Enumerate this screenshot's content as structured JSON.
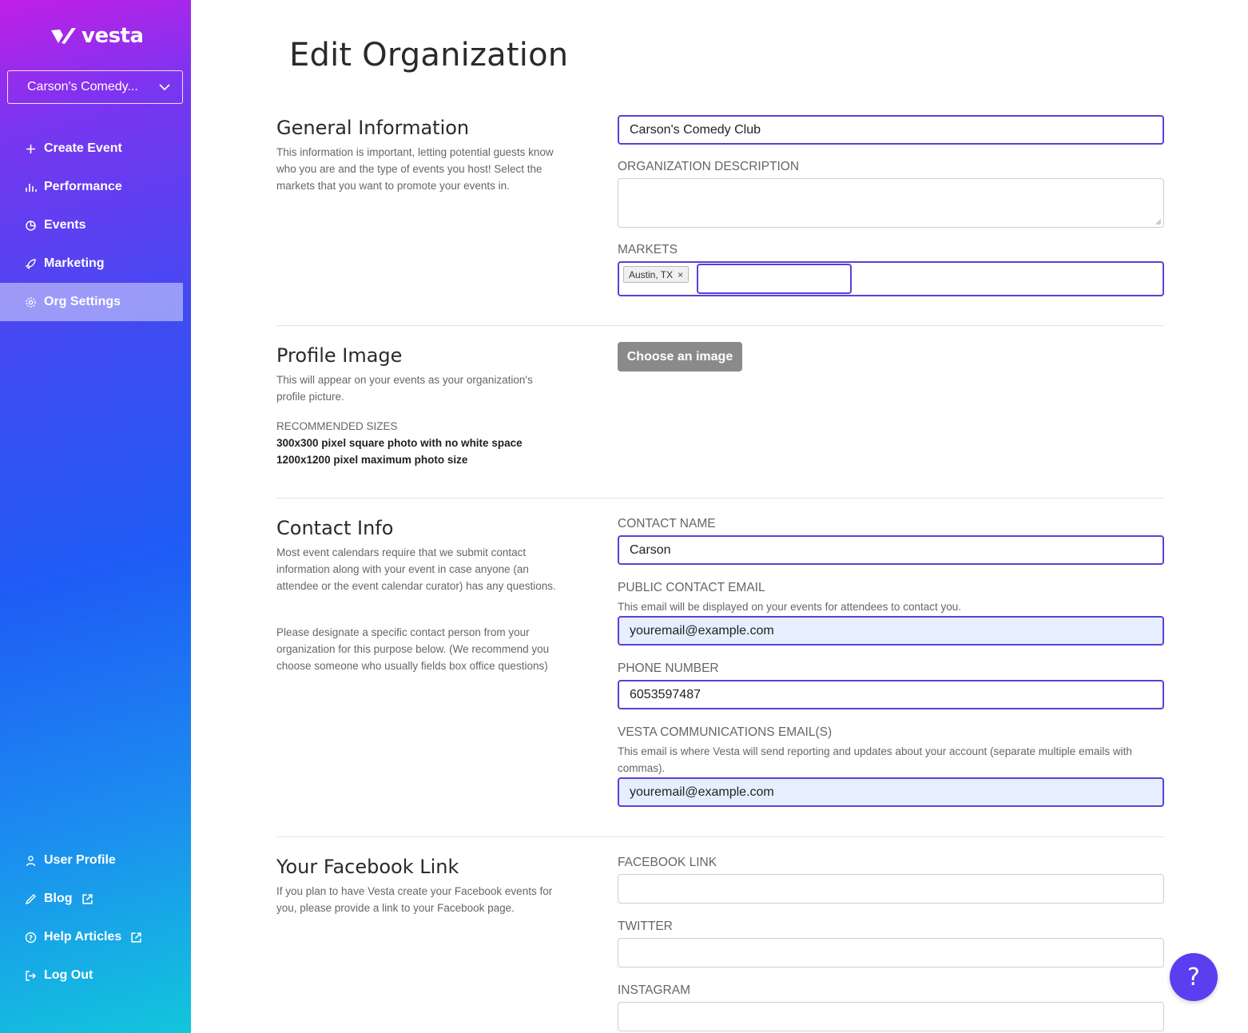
{
  "sidebar": {
    "logo_text": "vesta",
    "org_selector": "Carson's Comedy...",
    "nav_items": [
      {
        "label": "Create Event",
        "icon": "plus-icon"
      },
      {
        "label": "Performance",
        "icon": "bar-chart-icon"
      },
      {
        "label": "Events",
        "icon": "pie-chart-icon"
      },
      {
        "label": "Marketing",
        "icon": "rocket-icon"
      },
      {
        "label": "Org Settings",
        "icon": "gear-icon",
        "active": true
      }
    ],
    "bottom_items": [
      {
        "label": "User Profile",
        "icon": "user-icon"
      },
      {
        "label": "Blog",
        "icon": "pen-icon",
        "external": true
      },
      {
        "label": "Help Articles",
        "icon": "help-circle-icon",
        "external": true
      },
      {
        "label": "Log Out",
        "icon": "logout-icon"
      }
    ]
  },
  "page": {
    "title": "Edit Organization"
  },
  "general": {
    "title": "General Information",
    "description": "This information is important, letting potential guests know who you are and the type of events you host! Select the markets that you want to promote your events in.",
    "org_name_value": "Carson's Comedy Club",
    "org_description_label": "ORGANIZATION DESCRIPTION",
    "org_description_value": "",
    "markets_label": "MARKETS",
    "markets_tags": [
      "Austin, TX"
    ],
    "tag_remove": "×"
  },
  "profile_image": {
    "title": "Profile Image",
    "description": "This will appear on your events as your organization's profile picture.",
    "recommended_label": "RECOMMENDED SIZES",
    "recommended_lines": [
      "300x300 pixel square photo with no white space",
      "1200x1200 pixel maximum photo size"
    ],
    "choose_button": "Choose an image"
  },
  "contact": {
    "title": "Contact Info",
    "description_1": "Most event calendars require that we submit contact information along with your event in case anyone (an attendee or the event calendar curator) has any questions.",
    "description_2": "Please designate a specific contact person from your organization for this purpose below. (We recommend you choose someone who usually fields box office questions)",
    "contact_name_label": "CONTACT NAME",
    "contact_name_value": "Carson",
    "public_email_label": "PUBLIC CONTACT EMAIL",
    "public_email_help": "This email will be displayed on your events for attendees to contact you.",
    "public_email_value": "youremail@example.com",
    "phone_label": "PHONE NUMBER",
    "phone_value": "6053597487",
    "vesta_email_label": "VESTA COMMUNICATIONS EMAIL(S)",
    "vesta_email_help": "This email is where Vesta will send reporting and updates about your account (separate multiple emails with commas).",
    "vesta_email_value": "youremail@example.com"
  },
  "facebook": {
    "title": "Your Facebook Link",
    "description": "If you plan to have Vesta create your Facebook events for you, please provide a link to your Facebook page.",
    "facebook_label": "FACEBOOK LINK",
    "facebook_value": "",
    "twitter_label": "TWITTER",
    "twitter_value": "",
    "instagram_label": "INSTAGRAM",
    "instagram_value": ""
  },
  "help_button": {
    "glyph": "?",
    "color": "#5b3ef0"
  },
  "colors": {
    "accent_border": "#5c3fd9",
    "autofill_bg": "#e6efff",
    "button_gray": "#8a8a8a"
  }
}
